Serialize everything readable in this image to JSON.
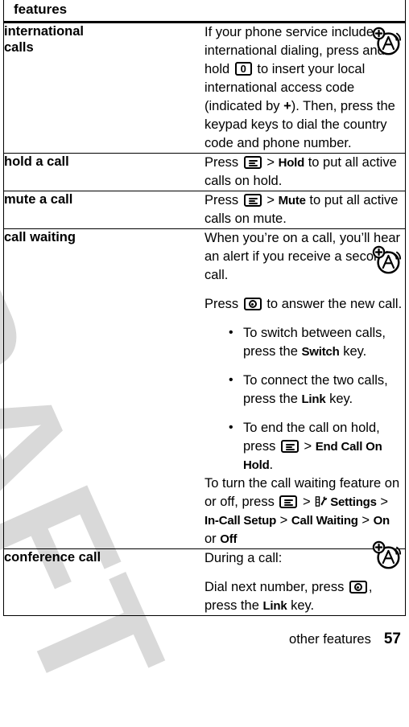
{
  "document": {
    "table_header": "features",
    "watermark": "DRAFT"
  },
  "rows": [
    {
      "term": "international calls",
      "term_line1": "international",
      "term_line2": "calls",
      "margin_icon": "network-service-icon",
      "paragraphs": [
        {
          "segments": [
            {
              "type": "text",
              "text": "If your phone service includes international dialing, press and hold "
            },
            {
              "type": "key",
              "icon": "zero-key-icon",
              "label": "0"
            },
            {
              "type": "text",
              "text": " to insert your local international access code (indicated by "
            },
            {
              "type": "bold",
              "text": "+"
            },
            {
              "type": "text",
              "text": "). Then, press the keypad keys to dial the country code and phone number."
            }
          ]
        }
      ]
    },
    {
      "term": "hold a call",
      "paragraphs": [
        {
          "segments": [
            {
              "type": "text",
              "text": "Press "
            },
            {
              "type": "key",
              "icon": "menu-key-icon"
            },
            {
              "type": "text",
              "text": " > "
            },
            {
              "type": "ui",
              "text": "Hold"
            },
            {
              "type": "text",
              "text": " to put all active calls on hold."
            }
          ]
        }
      ]
    },
    {
      "term": "mute a call",
      "paragraphs": [
        {
          "segments": [
            {
              "type": "text",
              "text": "Press "
            },
            {
              "type": "key",
              "icon": "menu-key-icon"
            },
            {
              "type": "text",
              "text": " > "
            },
            {
              "type": "ui",
              "text": "Mute"
            },
            {
              "type": "text",
              "text": " to put all active calls on mute."
            }
          ]
        }
      ]
    },
    {
      "term": "call waiting",
      "margin_icon": "network-service-icon",
      "paragraphs": [
        {
          "segments": [
            {
              "type": "text",
              "text": "When you’re on a call, you’ll hear an alert if you receive a second call."
            }
          ]
        },
        {
          "segments": [
            {
              "type": "text",
              "text": "Press "
            },
            {
              "type": "key",
              "icon": "send-key-icon"
            },
            {
              "type": "text",
              "text": " to answer the new call."
            }
          ]
        }
      ],
      "bullets": [
        {
          "segments": [
            {
              "type": "text",
              "text": "To switch between calls, press the "
            },
            {
              "type": "ui",
              "text": "Switch"
            },
            {
              "type": "text",
              "text": " key."
            }
          ]
        },
        {
          "segments": [
            {
              "type": "text",
              "text": "To connect the two calls, press the "
            },
            {
              "type": "ui",
              "text": "Link"
            },
            {
              "type": "text",
              "text": " key."
            }
          ]
        },
        {
          "segments": [
            {
              "type": "text",
              "text": "To end the call on hold, press "
            },
            {
              "type": "key",
              "icon": "menu-key-icon"
            },
            {
              "type": "text",
              "text": " > "
            },
            {
              "type": "ui",
              "text": "End Call On Hold"
            },
            {
              "type": "text",
              "text": "."
            }
          ]
        }
      ],
      "paragraphs_after": [
        {
          "segments": [
            {
              "type": "text",
              "text": "To turn the call waiting feature on or off, press "
            },
            {
              "type": "key",
              "icon": "menu-key-icon"
            },
            {
              "type": "text",
              "text": " > "
            },
            {
              "type": "icon",
              "icon": "settings-tools-icon"
            },
            {
              "type": "ui",
              "text": "Settings"
            },
            {
              "type": "text",
              "text": " > "
            },
            {
              "type": "ui",
              "text": "In-Call Setup"
            },
            {
              "type": "text",
              "text": " > "
            },
            {
              "type": "ui",
              "text": "Call Waiting"
            },
            {
              "type": "text",
              "text": " > "
            },
            {
              "type": "ui",
              "text": "On"
            },
            {
              "type": "text",
              "text": " or "
            },
            {
              "type": "ui",
              "text": "Off"
            }
          ]
        }
      ]
    },
    {
      "term": "conference call",
      "margin_icon": "network-service-icon",
      "paragraphs": [
        {
          "segments": [
            {
              "type": "text",
              "text": "During a call:"
            }
          ]
        },
        {
          "segments": [
            {
              "type": "text",
              "text": "Dial next number, press "
            },
            {
              "type": "key",
              "icon": "send-key-icon"
            },
            {
              "type": "text",
              "text": ", press the "
            },
            {
              "type": "ui",
              "text": "Link"
            },
            {
              "type": "text",
              "text": " key."
            }
          ]
        }
      ]
    }
  ],
  "footer": {
    "section": "other features",
    "page_number": "57"
  },
  "colors": {
    "text": "#000000",
    "background": "#ffffff",
    "watermark": "#d9d9d9",
    "rule": "#000000"
  }
}
